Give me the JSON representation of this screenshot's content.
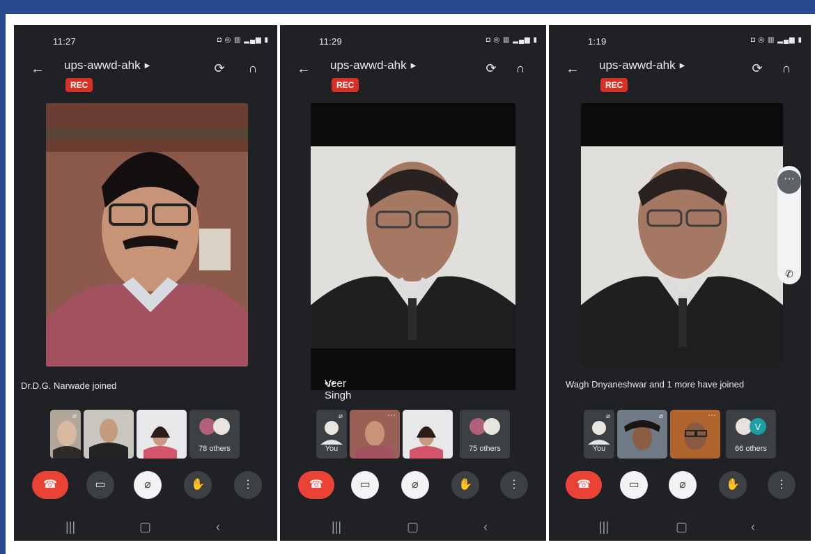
{
  "meeting_name": "ups-awwd-ahk",
  "rec_label": "REC",
  "phones": [
    {
      "time": "11:27",
      "join_text": "Dr.D.G. Narwade joined",
      "others": "78 others"
    },
    {
      "time": "11:29",
      "speaker_name": "Veer Singh",
      "you_label": "You",
      "others": "75 others"
    },
    {
      "time": "1:19",
      "join_text": "Wagh Dnyaneshwar and 1 more have joined",
      "you_label": "You",
      "others": "66 others",
      "avatar_letter": "V"
    }
  ],
  "colors": {
    "end_call": "#ea4335",
    "rec": "#d93025",
    "background": "#202124",
    "frame": "#2a4a8f"
  }
}
